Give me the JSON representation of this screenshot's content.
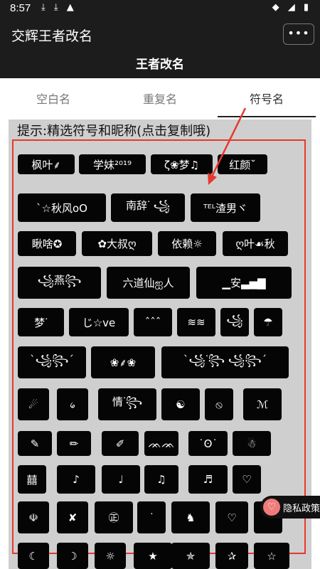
{
  "statusbar": {
    "time": "8:57",
    "left_icons": "⤓ ⤓ ▲",
    "right_icons": "◆ ◢ ▮"
  },
  "header": {
    "app_title": "交辉王者改名",
    "more_label": "•••"
  },
  "page": {
    "title": "王者改名"
  },
  "tabs": [
    {
      "label": "空白名"
    },
    {
      "label": "重复名"
    },
    {
      "label": "符号名"
    }
  ],
  "hint": "提示:精选符号和昵称(点击复制哦)",
  "symbols": [
    "枫叶⸙",
    "学妹²⁰¹⁹",
    "ζ❀梦♫",
    "红颜˘",
    "ˋ☆秋风oO",
    "南辞ᐝ ꧁",
    "ᵀᴱᴸ渣男ヾ",
    "瞅啥✪",
    "✿大叔ღ",
    "依赖☼",
    "ღ叶☙秋",
    "꧁燕꧂",
    "六道仙ஐ人",
    "▁安▃▅▇",
    "梦ᐝ",
    "じ☆ve",
    "ˆˆˆ",
    "≋≋",
    "꧁",
    "☂",
    "ˋ꧁꧂ˊ",
    "❀⸙❀",
    "ˋ꧁ᐝ꧂ ꧁꧂ˊ",
    "☄",
    "᥀",
    "情ᐝ꧂",
    "☯",
    "⦸",
    "ℳ",
    "✎",
    "✏",
    "✐",
    "ᨏᨏ",
    "˙ʘ˙",
    "☃",
    "囍",
    "♪",
    "♩",
    "♫",
    "♬",
    "♡",
    "☫",
    "✘",
    "㊣",
    "ᐝ",
    "♞",
    "♡",
    "ᐝ",
    "☾",
    "☽",
    "☼",
    "★",
    "✯",
    "✰",
    "☆"
  ],
  "privacy": {
    "label": "隐私政策",
    "icon": "heart-icon"
  },
  "colors": {
    "accent_red": "#e8382c",
    "bar": "#1c1c1c",
    "panel": "#cfcfcf"
  }
}
